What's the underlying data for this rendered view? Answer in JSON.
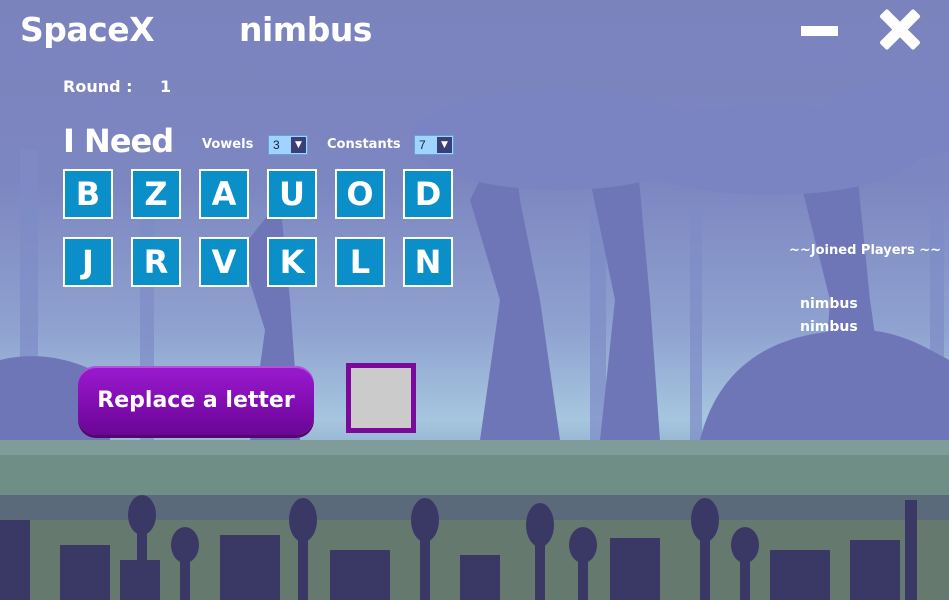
{
  "window": {
    "app_title": "SpaceX",
    "player_name": "nimbus"
  },
  "round": {
    "label": "Round :",
    "value": "1"
  },
  "need": {
    "label": "I Need",
    "vowels_label": "Vowels",
    "vowels_value": "3",
    "consonants_label": "Constants",
    "consonants_value": "7"
  },
  "tiles": {
    "row1": [
      "B",
      "Z",
      "A",
      "U",
      "O",
      "D"
    ],
    "row2": [
      "J",
      "R",
      "V",
      "K",
      "L",
      "N"
    ]
  },
  "actions": {
    "replace_label": "Replace a letter"
  },
  "players": {
    "header": "~~Joined Players ~~",
    "list": [
      "nimbus",
      "nimbus"
    ]
  },
  "colors": {
    "tile_bg": "#0b8fc8",
    "button_bg": "#8a12c0",
    "slot_border": "#7a0a9a"
  },
  "icons": [
    "minimize-icon",
    "close-icon",
    "dropdown-arrow-icon"
  ]
}
